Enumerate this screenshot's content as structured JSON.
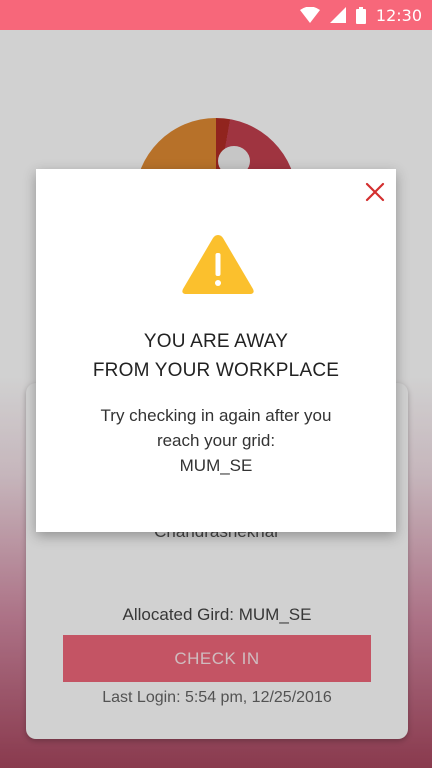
{
  "status_bar": {
    "time": "12:30",
    "bg_color": "#f7677a",
    "icons": [
      "wifi-icon",
      "signal-icon",
      "battery-icon"
    ]
  },
  "profile": {
    "name": "Chandrashekhar",
    "allocated_grid": "Allocated Gird: MUM_SE",
    "check_in_label": "CHECK IN",
    "last_login": "Last Login: 5:54 pm, 12/25/2016",
    "accent_color": "#f0677a"
  },
  "dialog": {
    "title_line1": "YOU ARE AWAY",
    "title_line2": "FROM YOUR WORKPLACE",
    "message_line1": "Try checking in again after you",
    "message_line2": "reach your grid:",
    "grid": "MUM_SE",
    "close_icon": "close-icon",
    "warning_icon": "warning-icon",
    "close_color": "#d32f2f",
    "warning_color": "#fbc02d"
  }
}
